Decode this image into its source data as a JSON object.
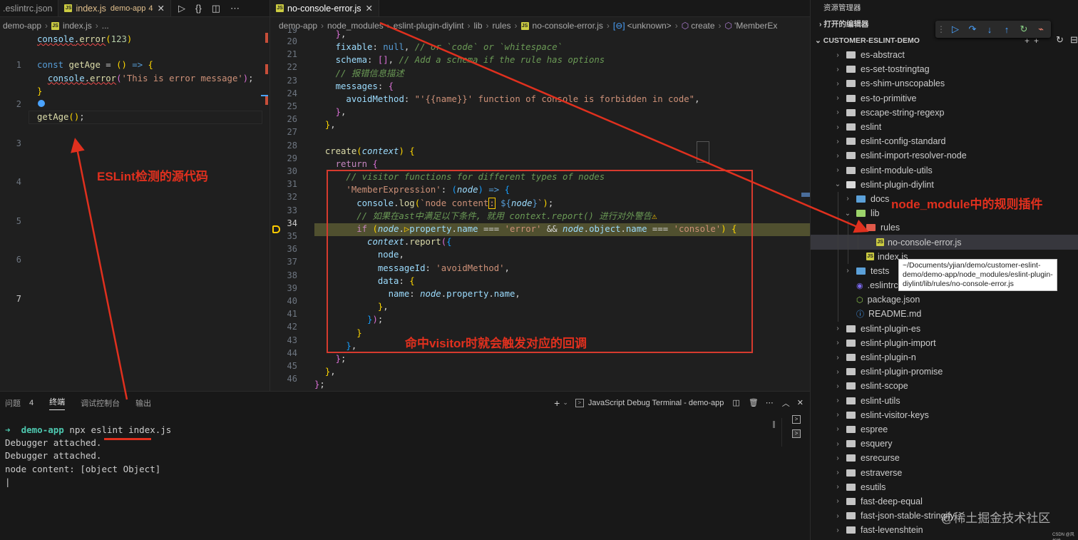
{
  "left_editor": {
    "tabs": [
      {
        "label": ".eslintrc.json"
      },
      {
        "label": "index.js",
        "description": "demo-app",
        "problems": "4",
        "close": "✕"
      }
    ],
    "breadcrumb": [
      "demo-app",
      "index.js",
      "..."
    ],
    "line_numbers": [
      "1",
      "2",
      "3",
      "4",
      "5",
      "6",
      "7"
    ]
  },
  "right_editor": {
    "tab": {
      "label": "no-console-error.js",
      "close": "✕"
    },
    "breadcrumb": [
      "demo-app",
      "node_modules",
      "eslint-plugin-diylint",
      "lib",
      "rules",
      "no-console-error.js",
      "<unknown>",
      "create",
      "'MemberEx"
    ],
    "line_numbers": [
      "19",
      "20",
      "21",
      "22",
      "23",
      "24",
      "25",
      "26",
      "27",
      "28",
      "29",
      "30",
      "31",
      "32",
      "33",
      "34",
      "35",
      "36",
      "37",
      "38",
      "39",
      "40",
      "41",
      "42",
      "43",
      "44",
      "45",
      "46"
    ]
  },
  "panel": {
    "tabs": {
      "problems": "问题",
      "problems_count": "4",
      "terminal": "终端",
      "debug_console": "调试控制台",
      "output": "输出"
    },
    "terminal_name": "JavaScript Debug Terminal - demo-app",
    "lines": {
      "prompt_dir": "demo-app",
      "command": "npx eslint index.js",
      "out1": "Debugger attached.",
      "out2": "Debugger attached.",
      "out3": "node content: [object Object]"
    }
  },
  "explorer": {
    "title": "资源管理器",
    "open_editors": "打开的编辑器",
    "project": "CUSTOMER-ESLINT-DEMO",
    "items": [
      {
        "label": "es-abstract",
        "kind": "folder"
      },
      {
        "label": "es-set-tostringtag",
        "kind": "folder"
      },
      {
        "label": "es-shim-unscopables",
        "kind": "folder"
      },
      {
        "label": "es-to-primitive",
        "kind": "folder"
      },
      {
        "label": "escape-string-regexp",
        "kind": "folder"
      },
      {
        "label": "eslint",
        "kind": "folder"
      },
      {
        "label": "eslint-config-standard",
        "kind": "folder"
      },
      {
        "label": "eslint-import-resolver-node",
        "kind": "folder"
      },
      {
        "label": "eslint-module-utils",
        "kind": "folder"
      },
      {
        "label": "eslint-plugin-diylint",
        "kind": "folder-open"
      },
      {
        "label": "docs",
        "kind": "folder",
        "depth": 1
      },
      {
        "label": "lib",
        "kind": "folder-open",
        "depth": 1
      },
      {
        "label": "rules",
        "kind": "folder-open",
        "depth": 2
      },
      {
        "label": "no-console-error.js",
        "kind": "js",
        "depth": 3
      },
      {
        "label": "index.js",
        "kind": "js",
        "depth": 2
      },
      {
        "label": "tests",
        "kind": "folder",
        "depth": 1
      },
      {
        "label": ".eslintrc.",
        "kind": "eslint",
        "depth": 1
      },
      {
        "label": "package.json",
        "kind": "json",
        "depth": 1
      },
      {
        "label": "README.md",
        "kind": "info",
        "depth": 1
      },
      {
        "label": "eslint-plugin-es",
        "kind": "folder"
      },
      {
        "label": "eslint-plugin-import",
        "kind": "folder"
      },
      {
        "label": "eslint-plugin-n",
        "kind": "folder"
      },
      {
        "label": "eslint-plugin-promise",
        "kind": "folder"
      },
      {
        "label": "eslint-scope",
        "kind": "folder"
      },
      {
        "label": "eslint-utils",
        "kind": "folder"
      },
      {
        "label": "eslint-visitor-keys",
        "kind": "folder"
      },
      {
        "label": "espree",
        "kind": "folder"
      },
      {
        "label": "esquery",
        "kind": "folder"
      },
      {
        "label": "esrecurse",
        "kind": "folder"
      },
      {
        "label": "estraverse",
        "kind": "folder"
      },
      {
        "label": "esutils",
        "kind": "folder"
      },
      {
        "label": "fast-deep-equal",
        "kind": "folder"
      },
      {
        "label": "fast-json-stable-stringify",
        "kind": "folder"
      },
      {
        "label": "fast-levenshtein",
        "kind": "folder"
      }
    ],
    "tooltip": "~/Documents/yjian/demo/customer-eslint-\ndemo/demo-app/node_modules/eslint-plugin-\ndiylint/lib/rules/no-console-error.js"
  },
  "annotations": {
    "source": "ESLint检测的源代码",
    "plugin": "node_module中的规则插件",
    "callback": "命中visitor时就会触发对应的回调",
    "watermark": "@稀土掘金技术社区",
    "credit": "CSDN @风如也"
  },
  "colors": {
    "annotation": "#e0301e",
    "accent": "#0078d4"
  }
}
